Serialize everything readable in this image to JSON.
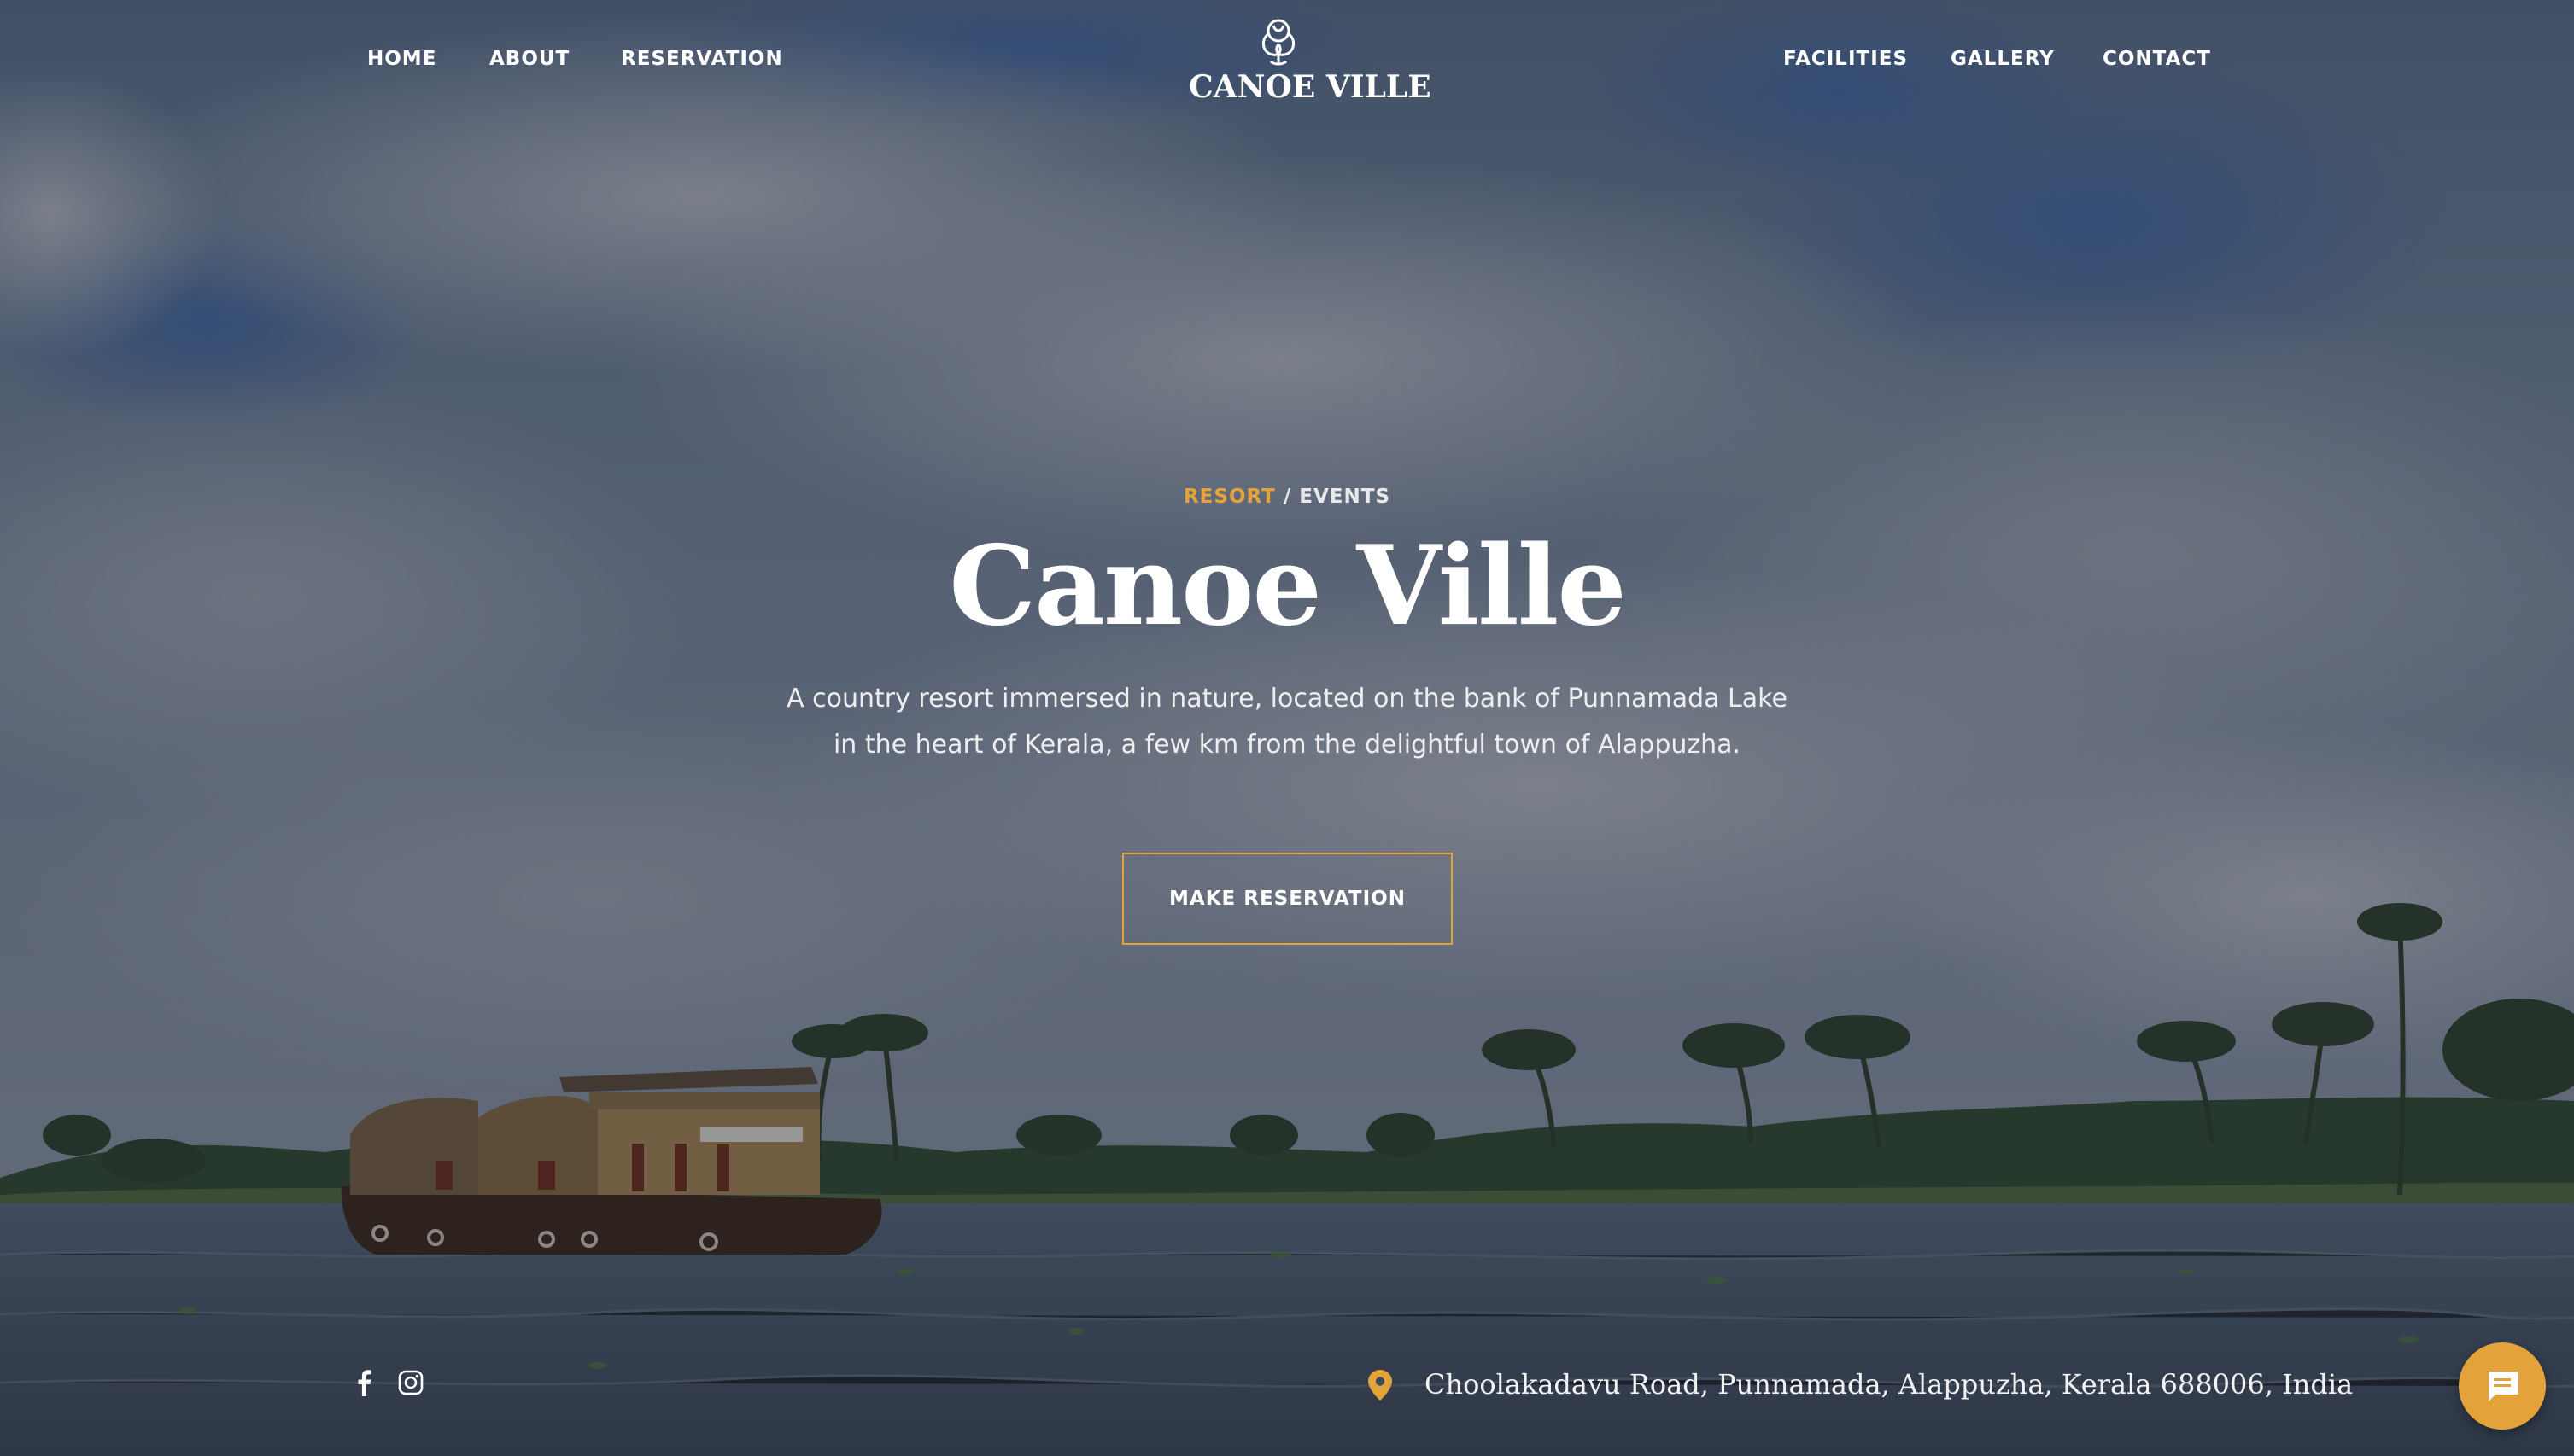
{
  "nav": {
    "left_links": [
      {
        "label": "HOME"
      },
      {
        "label": "ABOUT"
      },
      {
        "label": "RESERVATION"
      }
    ],
    "right_links": [
      {
        "label": "FACILITIES"
      },
      {
        "label": "GALLERY"
      },
      {
        "label": "CONTACT"
      }
    ],
    "logo_text": "CANOE VILLE",
    "logo_icon": "ornamental-monogram-icon"
  },
  "hero": {
    "eyebrow_accent": "RESORT",
    "eyebrow_separator": " / ",
    "eyebrow_rest": "EVENTS",
    "title": "Canoe Ville",
    "description_line1": "A country resort immersed in nature, located on the bank of Punnamada Lake",
    "description_line2": "in the heart of Kerala, a few km from the delightful town of Alappuzha.",
    "cta_label": "MAKE RESERVATION"
  },
  "footer_bar": {
    "social": [
      {
        "name": "facebook",
        "icon": "facebook-icon"
      },
      {
        "name": "instagram",
        "icon": "instagram-icon"
      }
    ],
    "address_icon": "map-pin-icon",
    "address": "Choolakadavu Road, Punnamada, Alappuzha, Kerala 688006, India"
  },
  "chat_widget": {
    "icon": "chat-icon"
  },
  "colors": {
    "accent": "#e3a33a",
    "text": "#ffffff",
    "overlay": "#1a202c"
  }
}
